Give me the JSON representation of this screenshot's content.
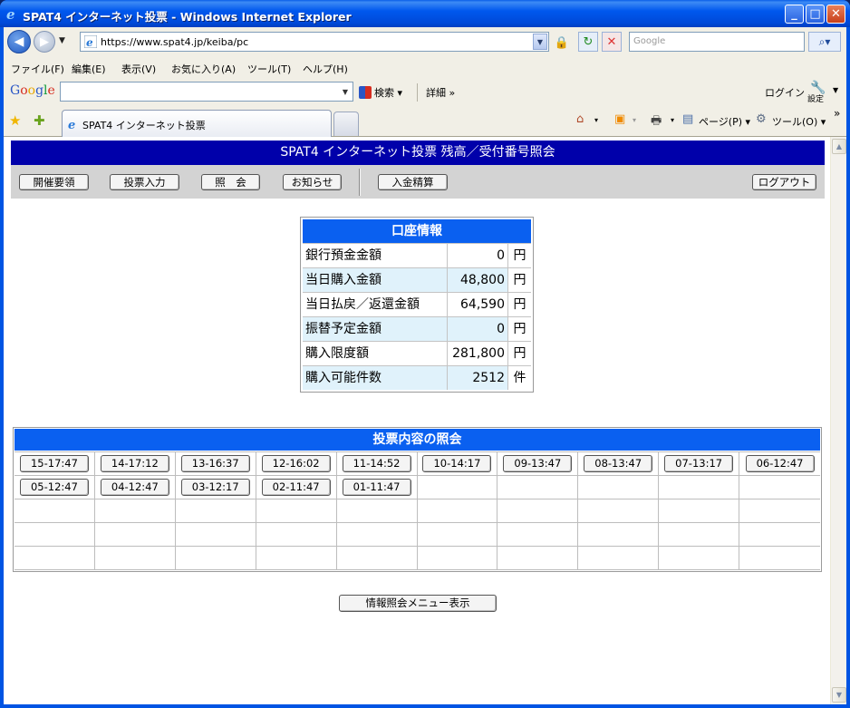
{
  "window": {
    "title": "SPAT4 インターネット投票 - Windows Internet Explorer"
  },
  "browser": {
    "address": "https://www.spat4.jp/keiba/pc",
    "search_placeholder": "Google",
    "menu": [
      "ファイル(F)",
      "編集(E)",
      "表示(V)",
      "お気に入り(A)",
      "ツール(T)",
      "ヘルプ(H)"
    ],
    "google_bar": {
      "logo": "Google",
      "search_label": "検索",
      "detail_label": "詳細 »",
      "login_label": "ログイン",
      "settings_label": "設定"
    },
    "tab_title": "SPAT4 インターネット投票",
    "commands": {
      "page": "ページ(P)",
      "tools": "ツール(O)"
    }
  },
  "page": {
    "header": "SPAT4 インターネット投票 残高／受付番号照会",
    "nav": {
      "guide": "開催要領",
      "vote": "投票入力",
      "inquiry": "照　会",
      "news": "お知らせ",
      "deposit": "入金精算",
      "logout": "ログアウト"
    },
    "account": {
      "title": "口座情報",
      "rows": [
        {
          "label": "銀行預金金額",
          "value": "0",
          "unit": "円"
        },
        {
          "label": "当日購入金額",
          "value": "48,800",
          "unit": "円"
        },
        {
          "label": "当日払戻／返還金額",
          "value": "64,590",
          "unit": "円"
        },
        {
          "label": "振替予定金額",
          "value": "0",
          "unit": "円"
        },
        {
          "label": "購入限度額",
          "value": "281,800",
          "unit": "円"
        },
        {
          "label": "購入可能件数",
          "value": "2512",
          "unit": "件"
        }
      ]
    },
    "inquiry": {
      "title": "投票内容の照会",
      "receipts": [
        "15-17:47",
        "14-17:12",
        "13-16:37",
        "12-16:02",
        "11-14:52",
        "10-14:17",
        "09-13:47",
        "08-13:47",
        "07-13:17",
        "06-12:47",
        "05-12:47",
        "04-12:47",
        "03-12:17",
        "02-11:47",
        "01-11:47"
      ]
    },
    "info_menu_button": "情報照会メニュー表示"
  },
  "colors": {
    "header_blue": "#0000aa",
    "section_blue": "#0a60f0",
    "alt_row": "#e0f2fb"
  }
}
